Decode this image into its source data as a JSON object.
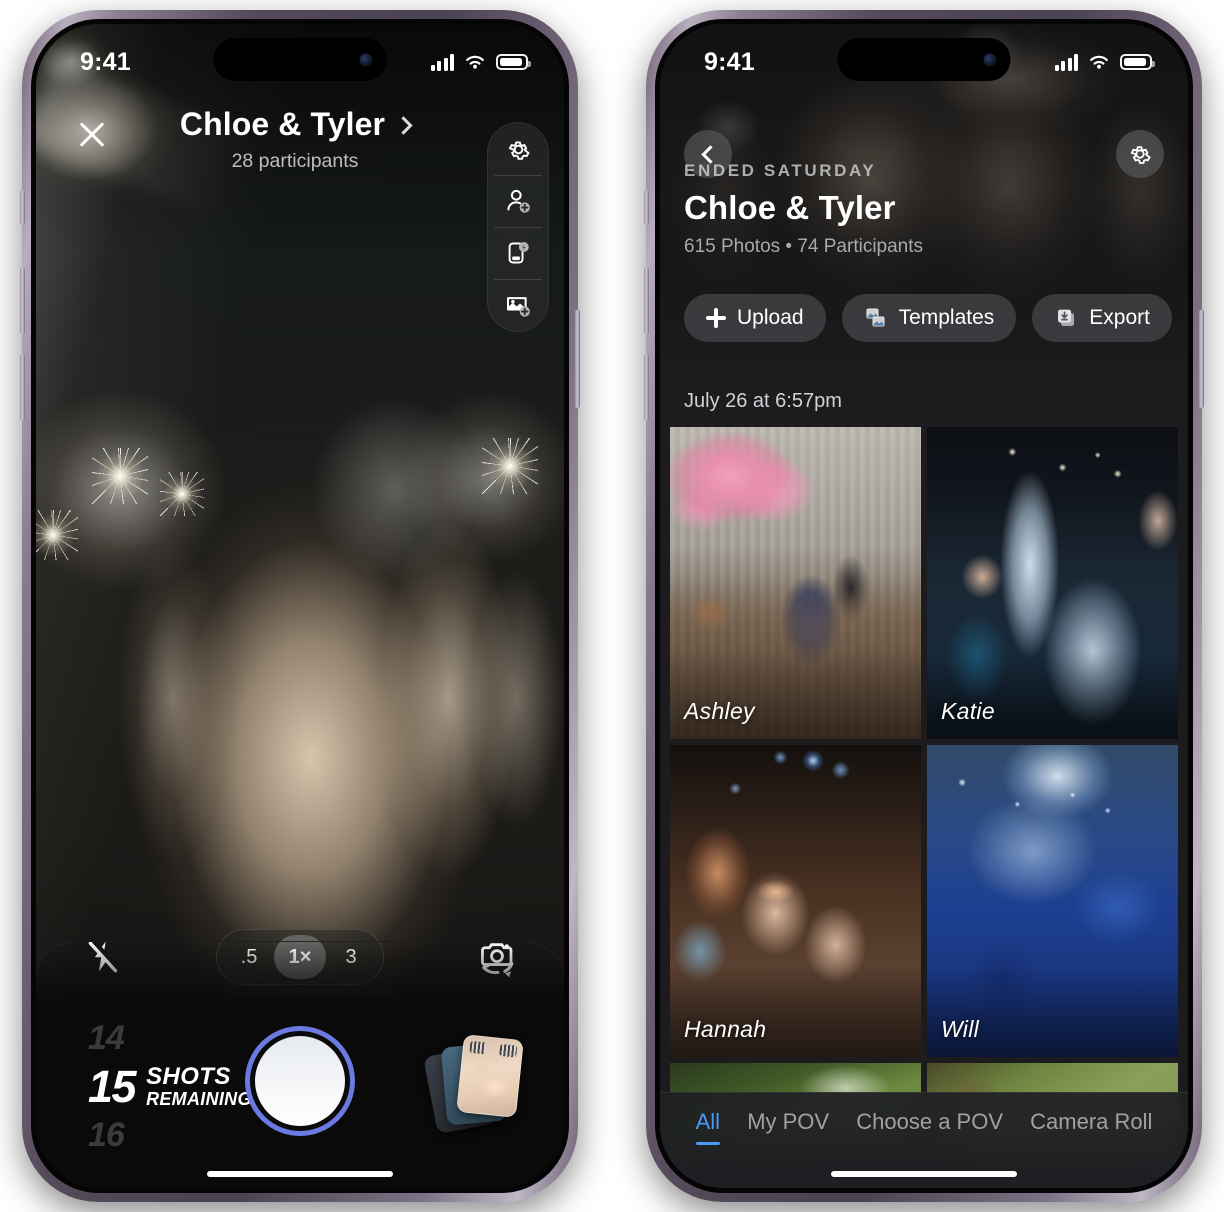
{
  "left_phone": {
    "status_bar": {
      "time": "9:41",
      "cellular_icon": "cellular-bars-icon",
      "wifi_icon": "wifi-icon",
      "battery_icon": "battery-icon"
    },
    "header": {
      "close_icon": "close-x-icon",
      "title": "Chloe & Tyler",
      "title_chevron_icon": "chevron-right-icon",
      "subtitle": "28 participants"
    },
    "tool_rail": [
      {
        "name": "settings",
        "icon": "gear-icon"
      },
      {
        "name": "add-participant",
        "icon": "add-person-icon"
      },
      {
        "name": "device-flash",
        "icon": "device-flash-icon"
      },
      {
        "name": "add-photo",
        "icon": "add-photo-icon"
      }
    ],
    "controls": {
      "flash_icon": "flash-off-icon",
      "flip_icon": "camera-flip-icon",
      "zoom_options": [
        ".5",
        "1×",
        "3"
      ],
      "zoom_selected": "1×"
    },
    "shots": {
      "previous": "14",
      "current": "15",
      "next": "16",
      "label_line1": "SHOTS",
      "label_line2": "REMAINING"
    },
    "shutter_name": "shutter-button",
    "gallery_stack_name": "photo-stack-thumbnail"
  },
  "right_phone": {
    "status_bar": {
      "time": "9:41",
      "cellular_icon": "cellular-bars-icon",
      "wifi_icon": "wifi-icon",
      "battery_icon": "battery-icon"
    },
    "hero": {
      "back_icon": "chevron-left-icon",
      "settings_icon": "gear-icon",
      "eyebrow": "ENDED SATURDAY",
      "title": "Chloe & Tyler",
      "meta": "615 Photos • 74 Participants",
      "actions": [
        {
          "label": "Upload",
          "icon": "plus-icon"
        },
        {
          "label": "Templates",
          "icon": "templates-icon"
        },
        {
          "label": "Export",
          "icon": "export-icon"
        }
      ]
    },
    "gallery": {
      "date_header": "July 26 at 6:57pm",
      "photos": [
        {
          "name": "Ashley",
          "desc": "cherry-blossom-bar"
        },
        {
          "name": "Katie",
          "desc": "dance-floor-hands"
        },
        {
          "name": "Hannah",
          "desc": "disco-ball-friends"
        },
        {
          "name": "Will",
          "desc": "blue-smoke-crowd"
        },
        {
          "name": "",
          "desc": "green-outdoor-1"
        },
        {
          "name": "",
          "desc": "green-outdoor-2"
        }
      ]
    },
    "tabs": [
      {
        "label": "All",
        "active": true
      },
      {
        "label": "My POV",
        "active": false
      },
      {
        "label": "Choose a POV",
        "active": false
      },
      {
        "label": "Camera Roll",
        "active": false
      }
    ]
  },
  "colors": {
    "accent_blue": "#4a9af5",
    "shutter_ring": "#6b7ae0",
    "gallery_bg": "#1c1c1e",
    "frame_purple": "#544a5a"
  }
}
